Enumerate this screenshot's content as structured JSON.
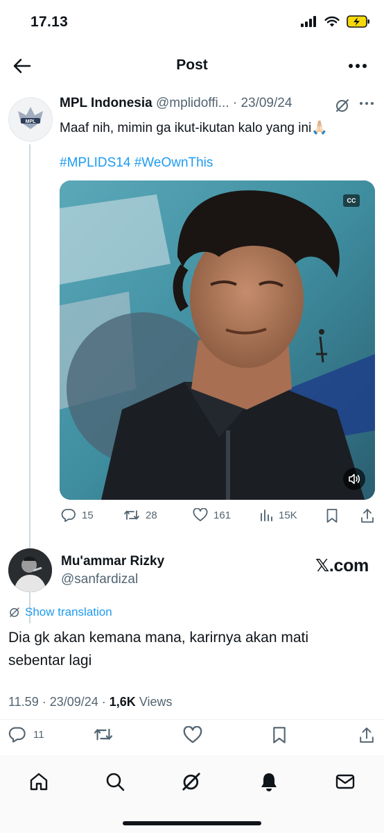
{
  "status": {
    "time": "17.13",
    "battery_color": "#f5d90a"
  },
  "topbar": {
    "title": "Post",
    "back_icon": "arrow-left-icon",
    "more_icon": "more-horizontal-icon"
  },
  "quoted_post": {
    "author_name": "MPL Indonesia",
    "handle": "@mplidoffi...",
    "date_sep": " · ",
    "date": "23/09/24",
    "text": "Maaf nih, mimin ga ikut-ikutan kalo yang ini🙏🏻",
    "hashtags": "#MPLIDS14 #WeOwnThis",
    "video_cc": "CC",
    "actions": {
      "replies": "15",
      "reposts": "28",
      "likes": "161",
      "views": "15K"
    }
  },
  "reply_post": {
    "author_name": "Mu'ammar Rizky",
    "handle": "@sanfardizal",
    "watermark": "𝕏.com",
    "translation_label": "Show translation",
    "text": "Dia gk akan kemana mana, karirnya akan mati sebentar lagi",
    "time": "11.59 · 23/09/24 · ",
    "views_count": "1,6K",
    "views_label": " Views",
    "actions": {
      "replies": "11"
    }
  },
  "colors": {
    "accent": "#1d9bf0",
    "text": "#0f1419",
    "secondary": "#536471"
  },
  "tabs": [
    "home-icon",
    "search-icon",
    "grok-icon",
    "notifications-icon",
    "messages-icon"
  ]
}
